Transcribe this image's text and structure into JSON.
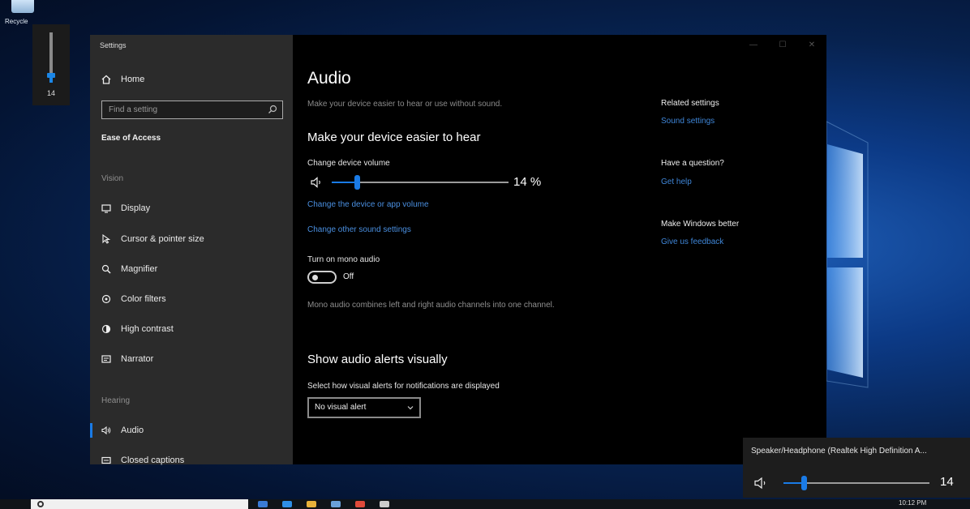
{
  "desktop": {
    "recycle_label": "Recycle"
  },
  "volume_osd": {
    "value": "14",
    "level": 0.14
  },
  "window": {
    "title": "Settings",
    "controls": [
      "—",
      "☐",
      "✕"
    ]
  },
  "sidebar": {
    "home": "Home",
    "search_placeholder": "Find a setting",
    "category": "Ease of Access",
    "vision_label": "Vision",
    "vision_items": [
      {
        "label": "Display",
        "icon": "display-icon"
      },
      {
        "label": "Cursor & pointer size",
        "icon": "cursor-icon"
      },
      {
        "label": "Magnifier",
        "icon": "magnifier-icon"
      },
      {
        "label": "Color filters",
        "icon": "color-filters-icon"
      },
      {
        "label": "High contrast",
        "icon": "high-contrast-icon"
      },
      {
        "label": "Narrator",
        "icon": "narrator-icon"
      }
    ],
    "hearing_label": "Hearing",
    "hearing_items": [
      {
        "label": "Audio",
        "icon": "audio-icon",
        "active": true
      },
      {
        "label": "Closed captions",
        "icon": "closed-captions-icon"
      }
    ]
  },
  "main": {
    "title": "Audio",
    "subtitle": "Make your device easier to hear or use without sound.",
    "section1": "Make your device easier to hear",
    "volume_label": "Change device volume",
    "volume_value": 14,
    "volume_text": "14 %",
    "link_app_volume": "Change the device or app volume",
    "link_other_sound": "Change other sound settings",
    "mono_label": "Turn on mono audio",
    "mono_state": "Off",
    "mono_desc": "Mono audio combines left and right audio channels into one channel.",
    "section2": "Show audio alerts visually",
    "alerts_label": "Select how visual alerts for notifications are displayed",
    "alerts_value": "No visual alert"
  },
  "related": {
    "heading": "Related settings",
    "sound_link": "Sound settings",
    "question_heading": "Have a question?",
    "help_link": "Get help",
    "better_heading": "Make Windows better",
    "feedback_link": "Give us feedback"
  },
  "flyout": {
    "device": "Speaker/Headphone (Realtek High Definition A...",
    "value": "14",
    "level": 0.14
  },
  "taskbar": {
    "clock": "10:12 PM"
  },
  "colors": {
    "accent": "#1a7be6",
    "link": "#4a8fe0",
    "sidebar_bg": "#2b2b2b",
    "window_bg": "#000000"
  }
}
